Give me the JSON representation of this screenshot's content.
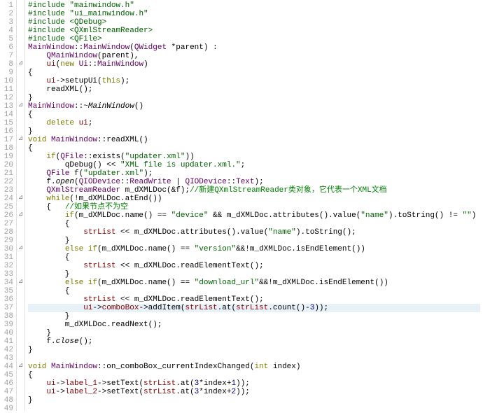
{
  "lines": [
    {
      "n": 1,
      "fold": "",
      "html": "<span class='pp'>#include</span> <span class='str'>\"mainwindow.h\"</span>"
    },
    {
      "n": 2,
      "fold": "",
      "html": "<span class='pp'>#include</span> <span class='str'>\"ui_mainwindow.h\"</span>"
    },
    {
      "n": 3,
      "fold": "",
      "html": "<span class='pp'>#include</span> <span class='str'>&lt;QDebug&gt;</span>"
    },
    {
      "n": 4,
      "fold": "",
      "html": "<span class='pp'>#include</span> <span class='str'>&lt;QXmlStreamReader&gt;</span>"
    },
    {
      "n": 5,
      "fold": "",
      "html": "<span class='pp'>#include</span> <span class='str'>&lt;QFile&gt;</span>"
    },
    {
      "n": 6,
      "fold": "",
      "html": "<span class='cls'>MainWindow</span>::<span class='cls'>MainWindow</span>(<span class='cls'>QWidget</span> *parent) :"
    },
    {
      "n": 7,
      "fold": "",
      "html": "    <span class='cls'>QMainWindow</span>(parent),"
    },
    {
      "n": 8,
      "fold": "⊿",
      "html": "    <span class='red'>ui</span>(<span class='kw'>new</span> <span class='cls'>Ui</span>::<span class='cls'>MainWindow</span>)"
    },
    {
      "n": 9,
      "fold": "",
      "html": "{"
    },
    {
      "n": 10,
      "fold": "",
      "html": "    <span class='red'>ui</span>-&gt;setupUi(<span class='kw'>this</span>);"
    },
    {
      "n": 11,
      "fold": "",
      "html": "    readXML();"
    },
    {
      "n": 12,
      "fold": "",
      "html": "}"
    },
    {
      "n": 13,
      "fold": "⊿",
      "html": "<span class='cls'>MainWindow</span>::~<span class='ital'>MainWindow</span>()"
    },
    {
      "n": 14,
      "fold": "",
      "html": "{"
    },
    {
      "n": 15,
      "fold": "",
      "html": "    <span class='kw'>delete</span> <span class='red'>ui</span>;"
    },
    {
      "n": 16,
      "fold": "",
      "html": "}"
    },
    {
      "n": 17,
      "fold": "⊿",
      "html": "<span class='kw'>void</span> <span class='cls'>MainWindow</span>::readXML()"
    },
    {
      "n": 18,
      "fold": "",
      "html": "{"
    },
    {
      "n": 19,
      "fold": "",
      "html": "    <span class='kw'>if</span>(<span class='cls'>QFile</span>::exists(<span class='str'>\"updater.xml\"</span>))"
    },
    {
      "n": 20,
      "fold": "",
      "html": "        qDebug() &lt;&lt; <span class='str'>\"XML file is updater.xml.\"</span>;"
    },
    {
      "n": 21,
      "fold": "",
      "html": "    <span class='cls'>QFile</span> f(<span class='str'>\"updater.xml\"</span>);"
    },
    {
      "n": 22,
      "fold": "",
      "html": "    f.<span class='ital'>open</span>(<span class='cls'>QIODevice</span>::<span class='cls'>ReadWrite</span> | <span class='cls'>QIODevice</span>::<span class='cls'>Text</span>);"
    },
    {
      "n": 23,
      "fold": "",
      "html": "    <span class='cls'>QXmlStreamReader</span> m_dXMLDoc(&amp;f);<span class='cmt'>//新建QXmlStreamReader类对象，它代表一个XML文档</span>"
    },
    {
      "n": 24,
      "fold": "⊿",
      "html": "    <span class='kw'>while</span>(!m_dXMLDoc.atEnd())"
    },
    {
      "n": 25,
      "fold": "",
      "html": "    {   <span class='cmt'>//如果节点不为空</span>"
    },
    {
      "n": 26,
      "fold": "⊿",
      "html": "        <span class='kw'>if</span>(m_dXMLDoc.name() == <span class='str'>\"device\"</span> &amp;&amp; m_dXMLDoc.attributes().value(<span class='str'>\"name\"</span>).toString() != <span class='str'>\"\"</span>)"
    },
    {
      "n": 27,
      "fold": "",
      "html": "        {"
    },
    {
      "n": 28,
      "fold": "",
      "html": "            <span class='red'>strList</span> &lt;&lt; m_dXMLDoc.attributes().value(<span class='str'>\"name\"</span>).toString();"
    },
    {
      "n": 29,
      "fold": "",
      "html": "        }"
    },
    {
      "n": 30,
      "fold": "⊿",
      "html": "        <span class='kw'>else</span> <span class='kw'>if</span>(m_dXMLDoc.name() == <span class='str'>\"version\"</span>&amp;&amp;!m_dXMLDoc.isEndElement())"
    },
    {
      "n": 31,
      "fold": "",
      "html": "        {"
    },
    {
      "n": 32,
      "fold": "",
      "html": "            <span class='red'>strList</span> &lt;&lt; m_dXMLDoc.readElementText();"
    },
    {
      "n": 33,
      "fold": "",
      "html": "        }"
    },
    {
      "n": 34,
      "fold": "⊿",
      "html": "        <span class='kw'>else</span> <span class='kw'>if</span>(m_dXMLDoc.name() == <span class='str'>\"download_url\"</span>&amp;&amp;!m_dXMLDoc.isEndElement())"
    },
    {
      "n": 35,
      "fold": "",
      "html": "        {"
    },
    {
      "n": 36,
      "fold": "",
      "html": "            <span class='red'>strList</span> &lt;&lt; m_dXMLDoc.readElementText();"
    },
    {
      "n": 37,
      "fold": "",
      "hl": true,
      "html": "            <span class='red'>ui</span>-&gt;<span class='red'>comboBox</span>-&gt;addItem(<span class='red'>strList</span>.at(<span class='red'>strList</span>.count()-<span class='num'>3</span>));"
    },
    {
      "n": 38,
      "fold": "",
      "html": "        }"
    },
    {
      "n": 39,
      "fold": "",
      "html": "        m_dXMLDoc.readNext();"
    },
    {
      "n": 40,
      "fold": "",
      "html": "    }"
    },
    {
      "n": 41,
      "fold": "",
      "html": "    f.<span class='ital'>close</span>();"
    },
    {
      "n": 42,
      "fold": "",
      "html": "}"
    },
    {
      "n": 43,
      "fold": "",
      "html": ""
    },
    {
      "n": 44,
      "fold": "⊿",
      "html": "<span class='kw'>void</span> <span class='cls'>MainWindow</span>::on_comboBox_currentIndexChanged(<span class='kw'>int</span> index)"
    },
    {
      "n": 45,
      "fold": "",
      "html": "{"
    },
    {
      "n": 46,
      "fold": "",
      "html": "    <span class='red'>ui</span>-&gt;<span class='red'>label_1</span>-&gt;setText(<span class='red'>strList</span>.at(<span class='num'>3</span>*index+<span class='num'>1</span>));"
    },
    {
      "n": 47,
      "fold": "",
      "html": "    <span class='red'>ui</span>-&gt;<span class='red'>label_2</span>-&gt;setText(<span class='red'>strList</span>.at(<span class='num'>3</span>*index+<span class='num'>2</span>));"
    },
    {
      "n": 48,
      "fold": "",
      "html": "}"
    },
    {
      "n": 49,
      "fold": "",
      "html": ""
    }
  ]
}
